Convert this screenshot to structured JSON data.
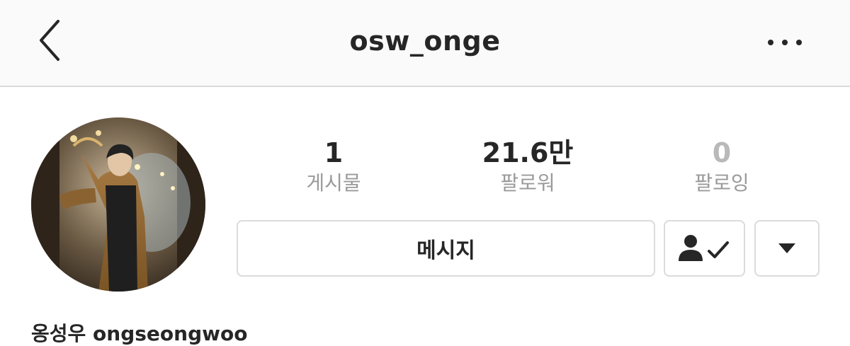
{
  "header": {
    "username": "osw_onge",
    "back_icon": "chevron-left-icon",
    "more_icon": "more-horizontal-icon"
  },
  "profile": {
    "avatar": "profile-photo",
    "stats": [
      {
        "count": "1",
        "label": "게시물"
      },
      {
        "count": "21.6만",
        "label": "팔로워"
      },
      {
        "count": "0",
        "label": "팔로잉"
      }
    ],
    "name_line": "옹성우 ongseongwoo"
  },
  "actions": {
    "message_label": "메시지",
    "following_icon": "person-check-icon",
    "dropdown_icon": "caret-down-icon"
  },
  "colors": {
    "header_bg": "#fafafa",
    "border": "#dbdbdb",
    "text": "#262626",
    "muted_label": "#9a9a9a"
  }
}
